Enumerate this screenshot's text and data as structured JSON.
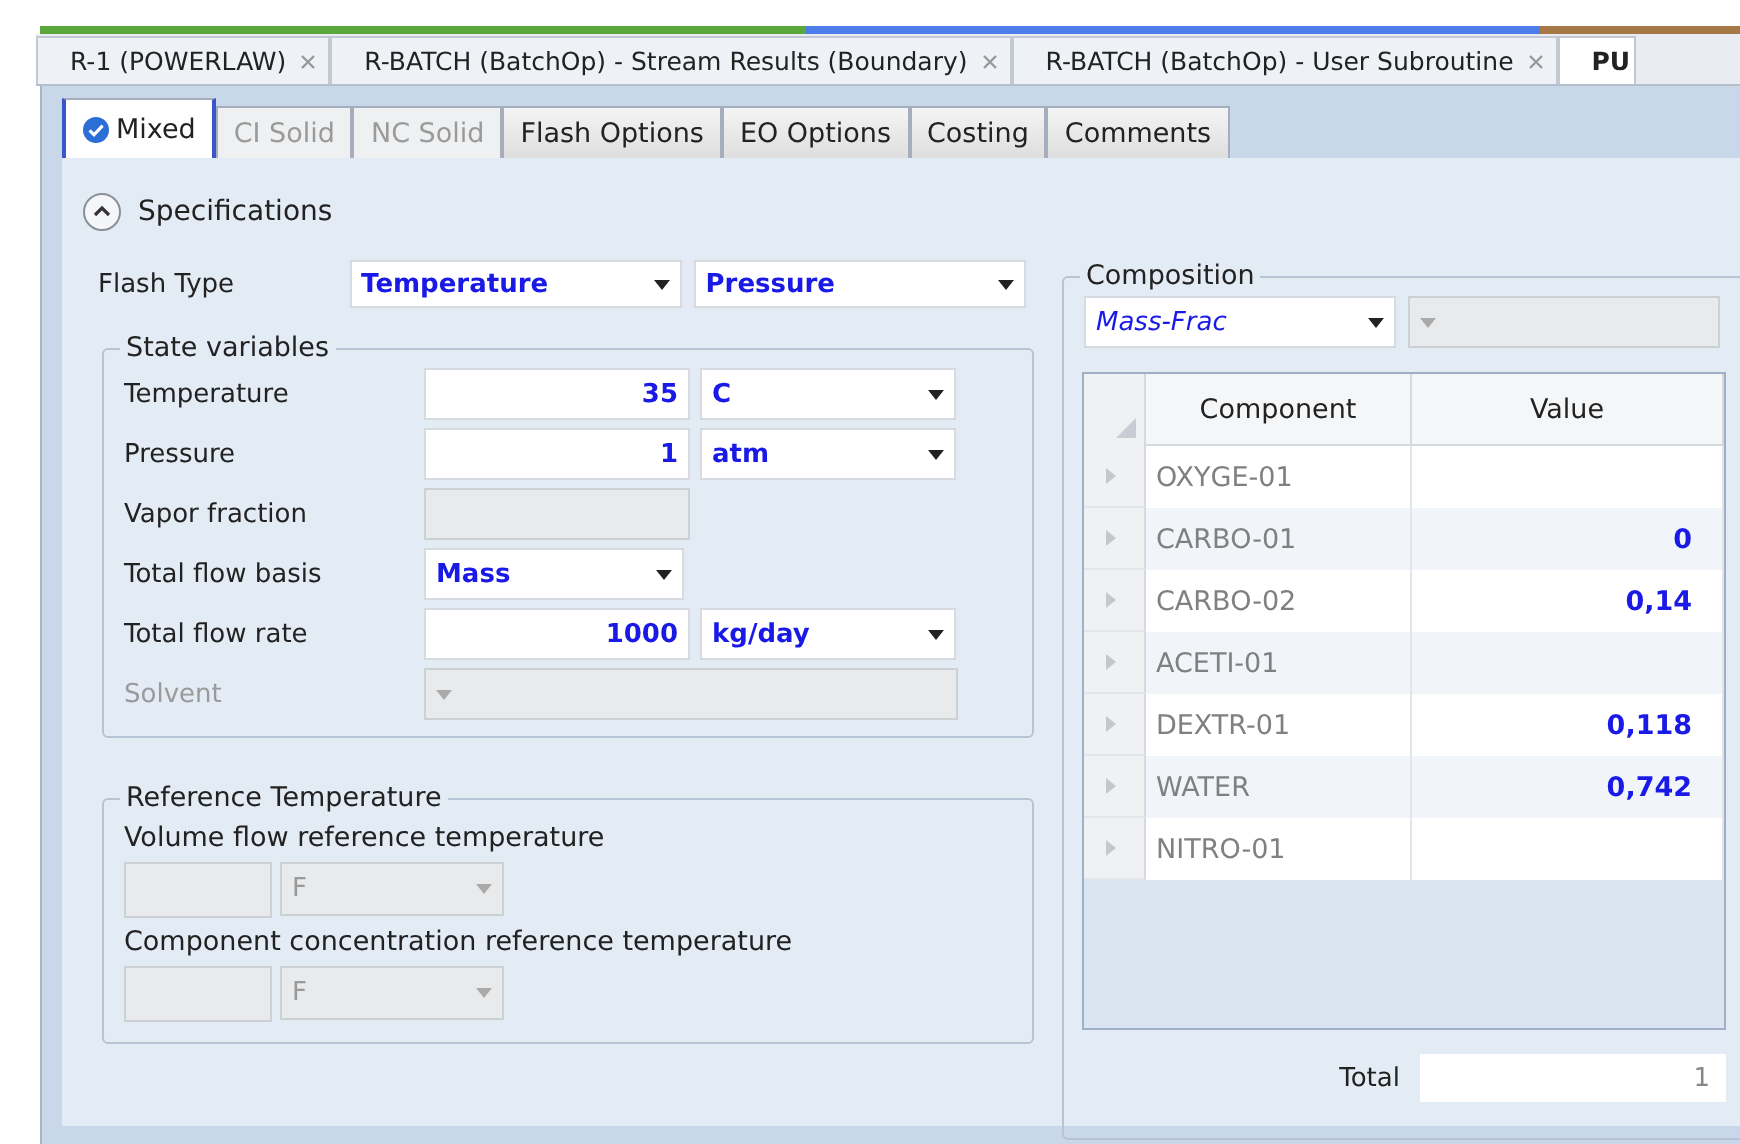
{
  "document_tabs": [
    {
      "label": "R-1 (POWERLAW)",
      "closable": true,
      "selected": false
    },
    {
      "label": "R-BATCH (BatchOp) - Stream Results (Boundary)",
      "closable": true,
      "selected": false
    },
    {
      "label": "R-BATCH (BatchOp) - User Subroutine",
      "closable": true,
      "selected": false
    },
    {
      "label": "PU",
      "closable": false,
      "selected": true
    }
  ],
  "form_tabs": [
    {
      "label": "Mixed",
      "selected": true,
      "disabled": false,
      "checked": true
    },
    {
      "label": "CI Solid",
      "selected": false,
      "disabled": true,
      "checked": false
    },
    {
      "label": "NC Solid",
      "selected": false,
      "disabled": true,
      "checked": false
    },
    {
      "label": "Flash Options",
      "selected": false,
      "disabled": false,
      "checked": false
    },
    {
      "label": "EO Options",
      "selected": false,
      "disabled": false,
      "checked": false
    },
    {
      "label": "Costing",
      "selected": false,
      "disabled": false,
      "checked": false
    },
    {
      "label": "Comments",
      "selected": false,
      "disabled": false,
      "checked": false
    }
  ],
  "section": {
    "title": "Specifications",
    "expanded": true
  },
  "flash_type": {
    "label": "Flash Type",
    "values": [
      "Temperature",
      "Pressure"
    ]
  },
  "state_variables": {
    "title": "State variables",
    "rows": [
      {
        "label": "Temperature",
        "disabled": false,
        "field": {
          "kind": "number",
          "value": "35",
          "disabled": false
        },
        "unit": {
          "value": "C",
          "disabled": false
        }
      },
      {
        "label": "Pressure",
        "disabled": false,
        "field": {
          "kind": "number",
          "value": "1",
          "disabled": false
        },
        "unit": {
          "value": "atm",
          "disabled": false
        }
      },
      {
        "label": "Vapor fraction",
        "disabled": false,
        "field": {
          "kind": "number",
          "disabled": true
        }
      },
      {
        "label": "Total flow basis",
        "disabled": false,
        "field": {
          "kind": "dropdown",
          "value": "Mass",
          "disabled": false
        }
      },
      {
        "label": "Total flow rate",
        "disabled": false,
        "field": {
          "kind": "number",
          "value": "1000",
          "disabled": false
        },
        "unit": {
          "value": "kg/day",
          "disabled": false
        }
      },
      {
        "label": "Solvent",
        "disabled": true,
        "field": {
          "kind": "wide_dropdown",
          "disabled": true
        }
      }
    ]
  },
  "reference_temperature": {
    "title": "Reference Temperature",
    "items": [
      {
        "label": "Volume flow reference temperature",
        "unit": {
          "value": "F",
          "disabled": true
        }
      },
      {
        "label": "Component concentration reference temperature",
        "unit": {
          "value": "F",
          "disabled": true
        }
      }
    ]
  },
  "composition": {
    "title": "Composition",
    "basis": "Mass-Frac",
    "columns": [
      "Component",
      "Value"
    ],
    "rows": [
      {
        "component": "OXYGE-01"
      },
      {
        "component": "CARBO-01",
        "value": "0"
      },
      {
        "component": "CARBO-02",
        "value": "0,14"
      },
      {
        "component": "ACETI-01"
      },
      {
        "component": "DEXTR-01",
        "value": "0,118"
      },
      {
        "component": "WATER",
        "value": "0,742"
      },
      {
        "component": "NITRO-01"
      }
    ],
    "total_label": "Total",
    "total_value": "1"
  }
}
